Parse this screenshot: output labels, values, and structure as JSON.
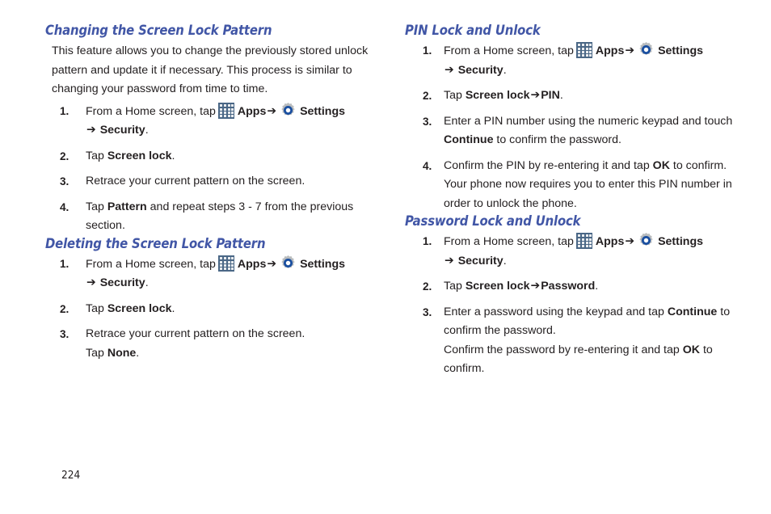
{
  "page": {
    "number": "224",
    "heading_color": "#4156a6",
    "body_color": "#231f20",
    "apps_icon_bg": "#4a6786",
    "gear_ring_color": "#1a4fa0",
    "gear_body_color": "#b9bcbe"
  },
  "icons": {
    "apps": "apps-grid-icon",
    "settings": "settings-gear-icon",
    "arrow": "➔"
  },
  "left_column": {
    "sections": [
      {
        "heading": "Changing the Screen Lock Pattern",
        "intro": "This feature allows you to change the previously stored unlock pattern and update it if necessary. This process is similar to changing your password from time to time.",
        "steps": [
          {
            "num": "1.",
            "type": "nav",
            "lead": "From a Home screen, tap",
            "apps_label": "Apps",
            "settings_label": "Settings",
            "tail": "Security",
            "tail_period": "."
          },
          {
            "num": "2.",
            "type": "rich",
            "pre": "Tap ",
            "bold": "Screen lock",
            "post": "."
          },
          {
            "num": "3.",
            "type": "plain",
            "text": "Retrace your current pattern on the screen."
          },
          {
            "num": "4.",
            "type": "rich",
            "pre": "Tap ",
            "bold": "Pattern",
            "post": " and repeat steps 3 - 7 from the previous section."
          }
        ]
      },
      {
        "heading": "Deleting the Screen Lock Pattern",
        "intro": "",
        "steps": [
          {
            "num": "1.",
            "type": "nav",
            "lead": "From a Home screen, tap",
            "apps_label": "Apps",
            "settings_label": "Settings",
            "tail": "Security",
            "tail_period": "."
          },
          {
            "num": "2.",
            "type": "rich",
            "pre": "Tap ",
            "bold": "Screen lock",
            "post": "."
          },
          {
            "num": "3.",
            "type": "rich-extra",
            "text": "Retrace your current pattern on the screen.",
            "extra_pre": "Tap ",
            "extra_bold": "None",
            "extra_post": "."
          }
        ]
      }
    ]
  },
  "right_column": {
    "sections": [
      {
        "heading": "PIN Lock and Unlock",
        "steps": [
          {
            "num": "1.",
            "type": "nav",
            "lead": "From a Home screen, tap",
            "apps_label": "Apps",
            "settings_label": "Settings",
            "tail": "Security",
            "tail_period": "."
          },
          {
            "num": "2.",
            "type": "rich2",
            "pre": "Tap ",
            "bold": "Screen lock",
            "mid": "",
            "bold2": "PIN",
            "post": "."
          },
          {
            "num": "3.",
            "type": "rich",
            "pre": "Enter a PIN number using the numeric keypad and touch ",
            "bold": "Continue",
            "post": " to confirm the password."
          },
          {
            "num": "4.",
            "type": "rich",
            "pre": "Confirm the PIN by re-entering it and tap ",
            "bold": "OK",
            "post": " to confirm. Your phone now requires you to enter this PIN number in order to unlock the phone."
          }
        ]
      },
      {
        "heading": "Password Lock and Unlock",
        "steps": [
          {
            "num": "1.",
            "type": "nav",
            "lead": "From a Home screen, tap",
            "apps_label": "Apps",
            "settings_label": "Settings",
            "tail": "Security",
            "tail_period": "."
          },
          {
            "num": "2.",
            "type": "rich2",
            "pre": "Tap ",
            "bold": "Screen lock",
            "mid": "",
            "bold2": "Password",
            "post": "."
          },
          {
            "num": "3.",
            "type": "rich-extra2",
            "pre": "Enter a password using the keypad and tap ",
            "bold": "Continue",
            "post": " to confirm the password.",
            "extra_pre": "Confirm the password by re-entering it and tap ",
            "extra_bold": "OK",
            "extra_post": " to confirm."
          }
        ]
      }
    ]
  }
}
